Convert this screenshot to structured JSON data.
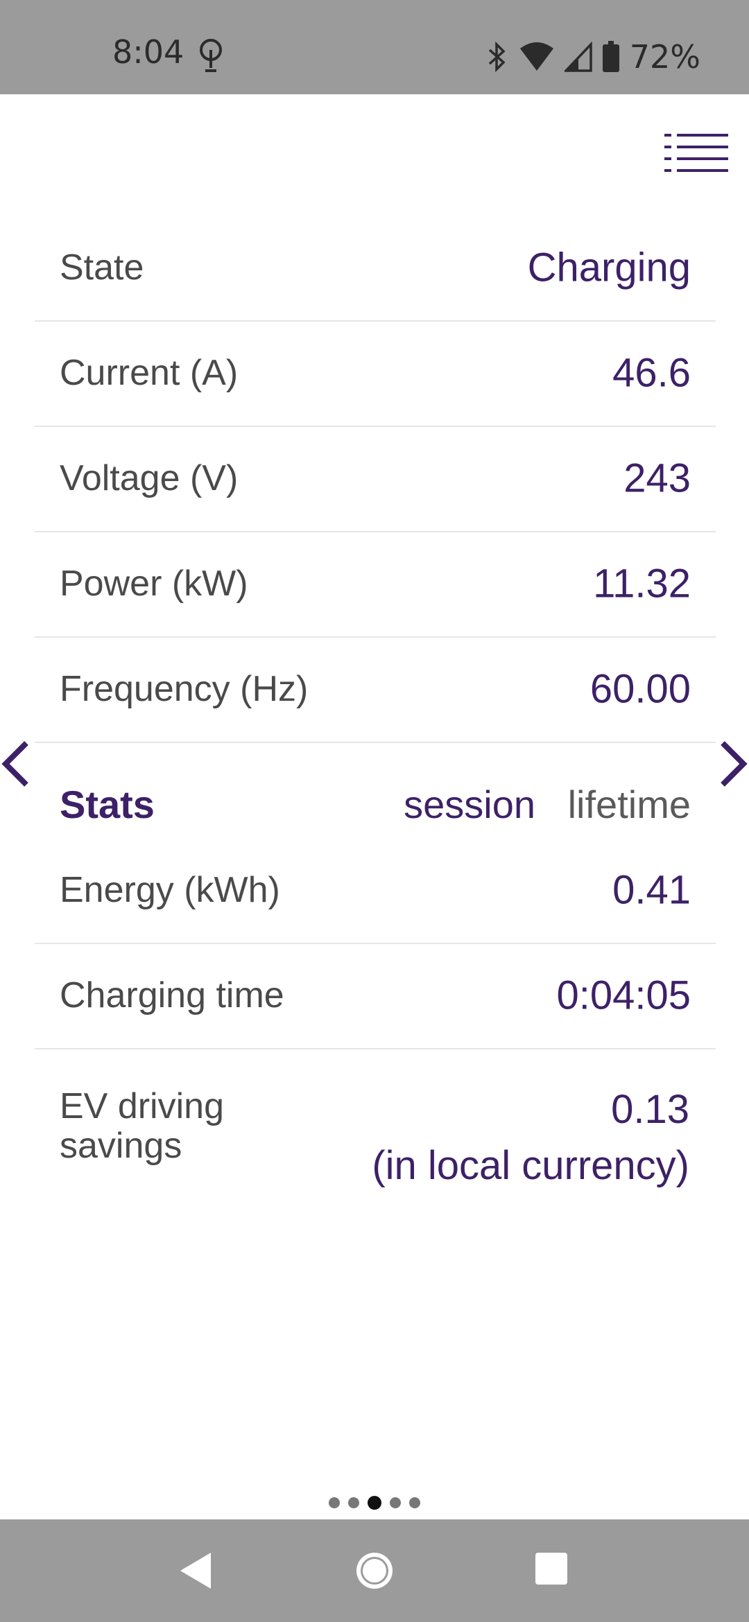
{
  "status_bar": {
    "time": "8:04",
    "battery_text": "72%",
    "icons": [
      "hotspot-icon",
      "bluetooth-icon",
      "wifi-icon",
      "cell-signal-icon",
      "battery-icon"
    ]
  },
  "menu": {
    "icon": "menu-list-icon"
  },
  "live_rows": [
    {
      "label": "State",
      "value": "Charging"
    },
    {
      "label": "Current (A)",
      "value": "46.6"
    },
    {
      "label": "Voltage (V)",
      "value": "243"
    },
    {
      "label": "Power (kW)",
      "value": "11.32"
    },
    {
      "label": "Frequency (Hz)",
      "value": "60.00"
    }
  ],
  "stats": {
    "title": "Stats",
    "tab_session": "session",
    "tab_lifetime": "lifetime",
    "rows": [
      {
        "label": "Energy (kWh)",
        "value": "0.41"
      },
      {
        "label": "Charging time",
        "value": "0:04:05"
      }
    ],
    "savings_label": "EV driving savings",
    "savings_value": "0.13",
    "savings_unit": "(in local currency)"
  },
  "pager": {
    "count": 5,
    "active_index": 2
  },
  "colors": {
    "accent": "#3d2167",
    "label": "#4a4a4a",
    "bars": "#9b9b9b"
  }
}
